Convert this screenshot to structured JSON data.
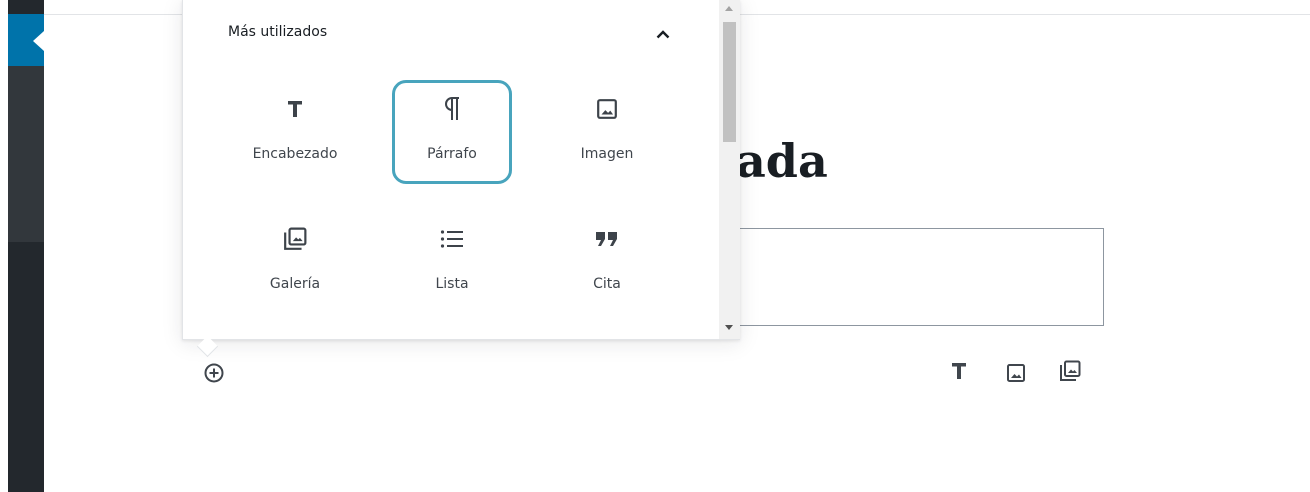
{
  "editor": {
    "post_title_partial": "ada"
  },
  "inserter": {
    "panel_title": "Más utilizados",
    "blocks": [
      {
        "label": "Encabezado",
        "icon": "heading-icon"
      },
      {
        "label": "Párrafo",
        "icon": "paragraph-icon",
        "selected": true
      },
      {
        "label": "Imagen",
        "icon": "image-icon"
      },
      {
        "label": "Galería",
        "icon": "gallery-icon"
      },
      {
        "label": "Lista",
        "icon": "list-icon"
      },
      {
        "label": "Cita",
        "icon": "quote-icon"
      }
    ]
  },
  "inline_toolbar": {
    "items": [
      "heading-icon",
      "image-icon",
      "gallery-icon"
    ]
  },
  "colors": {
    "admin_bar": "#23282d",
    "admin_accent": "#0073aa",
    "selected_outline": "#48a4bd",
    "text": "#191e23"
  }
}
